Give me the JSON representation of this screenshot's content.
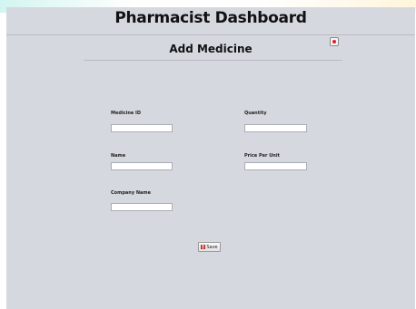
{
  "header": {
    "title": "Pharmacist Dashboard"
  },
  "form": {
    "title": "Add Medicine",
    "fields": {
      "medicine_id": {
        "label": "Medicine ID",
        "value": ""
      },
      "quantity": {
        "label": "Quantity",
        "value": ""
      },
      "name": {
        "label": "Name",
        "value": ""
      },
      "price_per_unit": {
        "label": "Price Per Unit",
        "value": ""
      },
      "company_name": {
        "label": "Company Name",
        "value": ""
      }
    },
    "save_label": "Save"
  },
  "icons": {
    "close": "close-icon",
    "save": "floppy-disk-icon"
  },
  "colors": {
    "panel_background": "#d5d8df",
    "close_accent": "#d7252b"
  }
}
